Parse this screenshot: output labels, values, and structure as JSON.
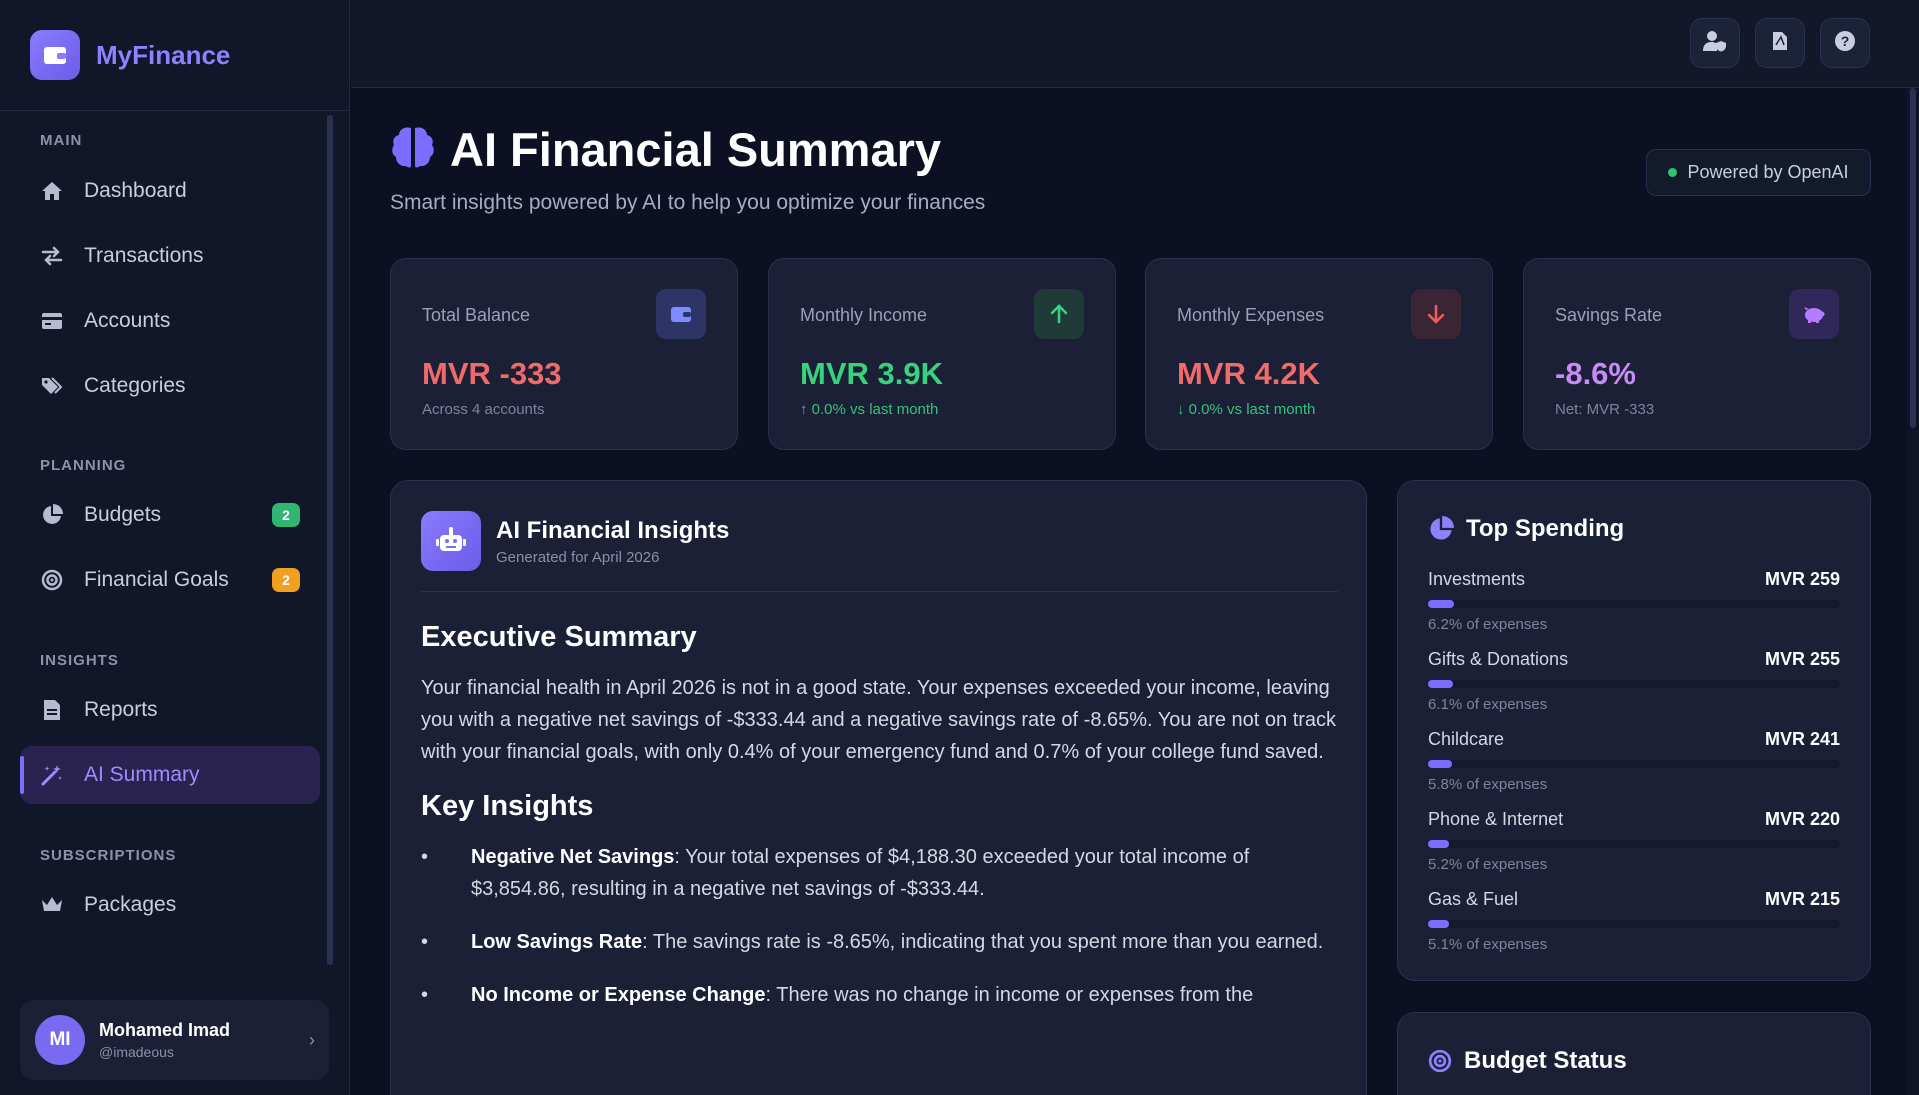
{
  "app": {
    "name": "MyFinance",
    "logo_icon": "wallet-icon"
  },
  "sidebar": {
    "sections": {
      "main": "MAIN",
      "planning": "PLANNING",
      "insights": "INSIGHTS",
      "subscriptions": "SUBSCRIPTIONS"
    },
    "items": {
      "dashboard": {
        "label": "Dashboard",
        "icon": "home-icon"
      },
      "transactions": {
        "label": "Transactions",
        "icon": "exchange-icon"
      },
      "accounts": {
        "label": "Accounts",
        "icon": "credit-card-icon"
      },
      "categories": {
        "label": "Categories",
        "icon": "tags-icon"
      },
      "budgets": {
        "label": "Budgets",
        "icon": "pie-chart-icon",
        "badge": "2",
        "badge_color": "#31b672"
      },
      "goals": {
        "label": "Financial Goals",
        "icon": "target-icon",
        "badge": "2",
        "badge_color": "#f0a020"
      },
      "reports": {
        "label": "Reports",
        "icon": "file-icon"
      },
      "ai_summary": {
        "label": "AI Summary",
        "icon": "magic-wand-icon",
        "active": true
      },
      "packages": {
        "label": "Packages",
        "icon": "crown-icon"
      }
    },
    "user": {
      "initials": "MI",
      "name": "Mohamed Imad",
      "handle": "@imadeous"
    }
  },
  "topbar": {
    "buttons": [
      "user-shield-icon",
      "file-pdf-icon",
      "help-icon"
    ]
  },
  "header": {
    "title": "AI Financial Summary",
    "subtitle": "Smart insights powered by AI to help you optimize your finances",
    "powered_by": "Powered by OpenAI"
  },
  "stats": {
    "balance": {
      "label": "Total Balance",
      "value": "MVR -333",
      "sub": "Across 4 accounts",
      "color": "#ef6b6b",
      "icon_bg": "#2c3566",
      "icon_color": "#7f8cff"
    },
    "income": {
      "label": "Monthly Income",
      "value": "MVR 3.9K",
      "sub": "0.0% vs last month",
      "color": "#38d27e",
      "icon_bg": "#1f3a37",
      "icon_color": "#38d27e"
    },
    "expenses": {
      "label": "Monthly Expenses",
      "value": "MVR 4.2K",
      "sub": "0.0% vs last month",
      "color": "#f16b6b",
      "icon_bg": "#3a2534",
      "icon_color": "#f15a5a"
    },
    "savings": {
      "label": "Savings Rate",
      "value": "-8.6%",
      "sub": "Net: MVR -333",
      "color": "#c78cf5",
      "icon_bg": "#31285a",
      "icon_color": "#b57cff"
    }
  },
  "insights": {
    "title": "AI Financial Insights",
    "generated": "Generated for April 2026",
    "executive_heading": "Executive Summary",
    "executive_text": "Your financial health in April 2026 is not in a good state. Your expenses exceeded your income, leaving you with a negative net savings of -$333.44 and a negative savings rate of -8.65%. You are not on track with your financial goals, with only 0.4% of your emergency fund and 0.7% of your college fund saved.",
    "key_heading": "Key Insights",
    "key_items": [
      {
        "title": "Negative Net Savings",
        "text": ": Your total expenses of $4,188.30 exceeded your total income of $3,854.86, resulting in a negative net savings of -$333.44."
      },
      {
        "title": "Low Savings Rate",
        "text": ": The savings rate is -8.65%, indicating that you spent more than you earned."
      },
      {
        "title": "No Income or Expense Change",
        "text": ": There was no change in income or expenses from the"
      }
    ]
  },
  "top_spending": {
    "title": "Top Spending",
    "items": [
      {
        "name": "Investments",
        "amount": "MVR 259",
        "pct_text": "6.2% of expenses",
        "pct": 6.2
      },
      {
        "name": "Gifts & Donations",
        "amount": "MVR 255",
        "pct_text": "6.1% of expenses",
        "pct": 6.1
      },
      {
        "name": "Childcare",
        "amount": "MVR 241",
        "pct_text": "5.8% of expenses",
        "pct": 5.8
      },
      {
        "name": "Phone & Internet",
        "amount": "MVR 220",
        "pct_text": "5.2% of expenses",
        "pct": 5.2
      },
      {
        "name": "Gas & Fuel",
        "amount": "MVR 215",
        "pct_text": "5.1% of expenses",
        "pct": 5.1
      }
    ]
  },
  "budget_status": {
    "title": "Budget Status"
  }
}
